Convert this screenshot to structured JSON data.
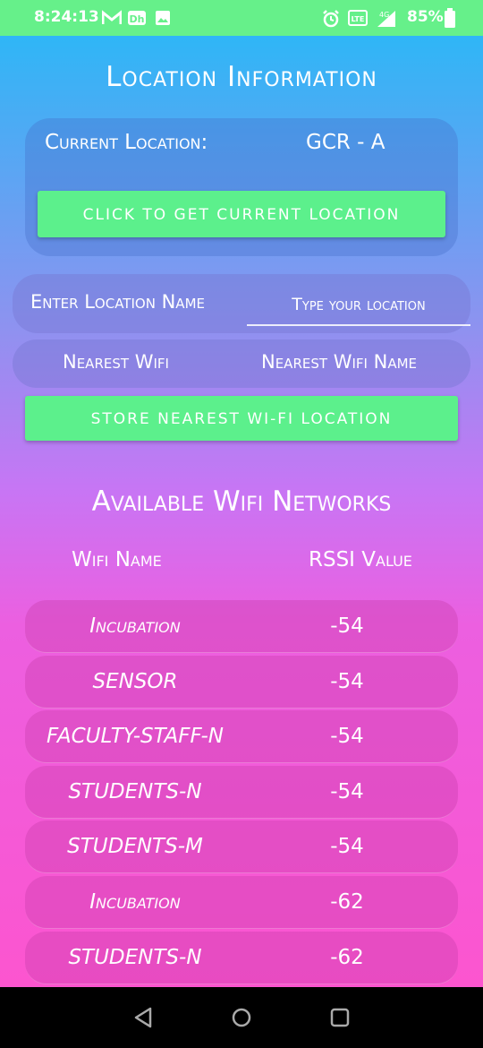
{
  "status_bar": {
    "time": "8:24:13",
    "battery": "85%",
    "network": "4G"
  },
  "page": {
    "title": "Location Information"
  },
  "current_location": {
    "label": "Current Location:",
    "value": "GCR - A",
    "button_label": "Click to get current location"
  },
  "enter_location": {
    "label": "Enter Location Name",
    "placeholder": "Type your location"
  },
  "nearest_wifi": {
    "label": "Nearest Wifi",
    "value": "Nearest Wifi Name"
  },
  "store_button_label": "Store nearest Wi-Fi location",
  "networks": {
    "title": "Available Wifi Networks",
    "col_name": "Wifi Name",
    "col_rssi": "RSSI Value",
    "rows": [
      {
        "name": "Incubation",
        "rssi": "-54"
      },
      {
        "name": "SENSOR",
        "rssi": "-54"
      },
      {
        "name": "FACULTY-STAFF-N",
        "rssi": "-54"
      },
      {
        "name": "STUDENTS-N",
        "rssi": "-54"
      },
      {
        "name": "STUDENTS-M",
        "rssi": "-54"
      },
      {
        "name": "Incubation",
        "rssi": "-62"
      },
      {
        "name": "STUDENTS-N",
        "rssi": "-62"
      }
    ]
  },
  "colors": {
    "status_bar": "#66f08a",
    "button": "#5cf08c",
    "gradient_top": "#2fb6f6",
    "gradient_bottom": "#fc55cf"
  }
}
